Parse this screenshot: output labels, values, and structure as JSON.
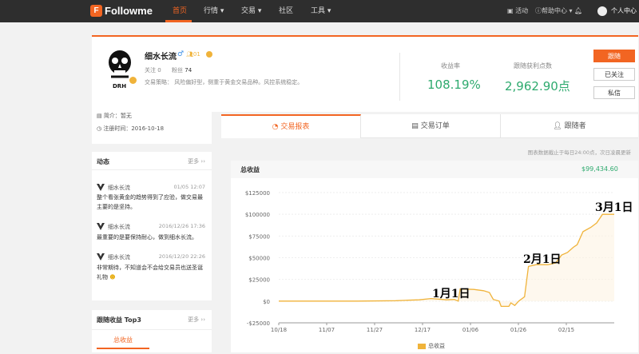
{
  "brand": "Followme",
  "nav": [
    "首页",
    "行情",
    "交易",
    "社区",
    "工具"
  ],
  "topright": {
    "activity": "活动",
    "help": "帮助中心",
    "user": "个人中心"
  },
  "profile": {
    "name": "细水长流",
    "level": "01",
    "follow_label": "关注",
    "follow_count": "0",
    "fans_label": "粉丝",
    "fans_count": "74",
    "strategy": "交易策略： 风险偏好型，侧重于黄金交易品种。风控系统稳定。",
    "avatar_text": "DRH"
  },
  "stats": {
    "rate_label": "收益率",
    "rate_value": "108.19%",
    "pts_label": "跟随获利点数",
    "pts_value": "2,962.90点"
  },
  "buttons": {
    "follow": "跟随",
    "followed": "已关注",
    "message": "私信"
  },
  "intro": {
    "brief": "简介：暂无",
    "reg": "注册时间：2016-10-18"
  },
  "feed": {
    "title": "动态",
    "more": "更多",
    "items": [
      {
        "name": "细水长流",
        "time": "01/05 12:07",
        "text": "整个看张黄金的趋势得到了应验，做交易最主要的是坚持。"
      },
      {
        "name": "细水长流",
        "time": "2016/12/26 17:36",
        "text": "最重要的是要保持耐心，做到细水长流。"
      },
      {
        "name": "细水长流",
        "time": "2016/12/20 22:26",
        "text": "非常期待，不知道会不会给交易员也送圣诞礼物"
      }
    ]
  },
  "top3": {
    "title": "跟随收益 Top3",
    "more": "更多",
    "tab": "总收益"
  },
  "tabs": [
    "交易报表",
    "交易订单",
    "跟随者"
  ],
  "chart_note": "图表数据截止于每日24:00点，次日凌晨更新",
  "chart_title": "总收益",
  "chart_total": "$99,434.60",
  "annotations": [
    "1月1日",
    "2月1日",
    "3月1日"
  ],
  "chart_data": {
    "type": "line",
    "x_ticks": [
      "10/18",
      "11/07",
      "11/27",
      "12/17",
      "01/06",
      "01/26",
      "02/15"
    ],
    "y_ticks": [
      "$125000",
      "$100000",
      "$75000",
      "$50000",
      "$25000",
      "$0",
      "-$25000"
    ],
    "ylim": [
      -25000,
      125000
    ],
    "series": [
      {
        "name": "总收益",
        "points": [
          [
            0,
            0
          ],
          [
            40,
            0
          ],
          [
            60,
            500
          ],
          [
            66,
            1000
          ],
          [
            72,
            1500
          ],
          [
            78,
            3000
          ],
          [
            84,
            2000
          ],
          [
            86,
            1500
          ],
          [
            90,
            2000
          ],
          [
            92,
            0
          ],
          [
            93,
            14000
          ],
          [
            100,
            13500
          ],
          [
            105,
            12000
          ],
          [
            108,
            10000
          ],
          [
            110,
            2000
          ],
          [
            113,
            0
          ],
          [
            114,
            -6000
          ],
          [
            118,
            -6000
          ],
          [
            119,
            -2000
          ],
          [
            121,
            -5000
          ],
          [
            123,
            0
          ],
          [
            126,
            5000
          ],
          [
            128,
            40000
          ],
          [
            132,
            42000
          ],
          [
            138,
            42000
          ],
          [
            142,
            44000
          ],
          [
            145,
            53000
          ],
          [
            148,
            56000
          ],
          [
            151,
            62000
          ],
          [
            153,
            65000
          ],
          [
            156,
            80000
          ],
          [
            160,
            85000
          ],
          [
            163,
            90000
          ],
          [
            166,
            100000
          ],
          [
            172,
            100000
          ]
        ]
      }
    ],
    "x_day_max": 172
  }
}
